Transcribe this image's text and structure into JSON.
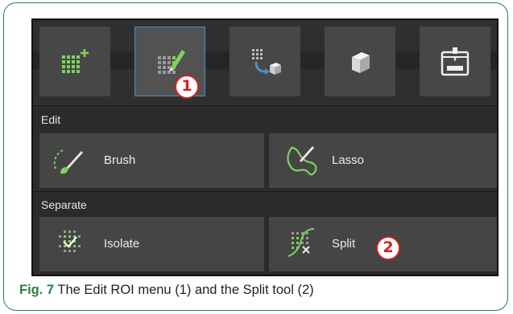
{
  "toolbar": {
    "tiles": [
      {
        "icon": "add-grid-icon",
        "selected": false
      },
      {
        "icon": "edit-roi-icon",
        "selected": true
      },
      {
        "icon": "export-grid-icon",
        "selected": false
      },
      {
        "icon": "cube-icon",
        "selected": false
      },
      {
        "icon": "3d-printer-icon",
        "selected": false
      }
    ]
  },
  "edit_section": {
    "label": "Edit",
    "buttons": [
      {
        "label": "Brush",
        "icon": "brush-icon"
      },
      {
        "label": "Lasso",
        "icon": "lasso-icon"
      }
    ]
  },
  "separate_section": {
    "label": "Separate",
    "buttons": [
      {
        "label": "Isolate",
        "icon": "isolate-icon"
      },
      {
        "label": "Split",
        "icon": "split-icon"
      }
    ]
  },
  "callouts": {
    "one": "1",
    "two": "2"
  },
  "caption": {
    "fig_label": "Fig. 7",
    "text": " The Edit ROI menu (1) and the Split tool (2)"
  },
  "colors": {
    "frame": "#2e7d44",
    "accent_green": "#7ed35a",
    "selection": "#4a90c8",
    "callout_red": "#d42020"
  }
}
